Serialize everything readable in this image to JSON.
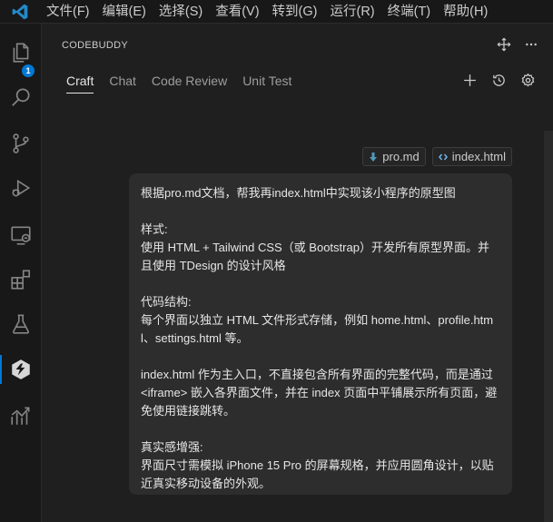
{
  "menu": [
    "文件(F)",
    "编辑(E)",
    "选择(S)",
    "查看(V)",
    "转到(G)",
    "运行(R)",
    "终端(T)",
    "帮助(H)"
  ],
  "activity": {
    "explorer_badge": "1"
  },
  "panel": {
    "title": "CODEBUDDY",
    "tabs": [
      "Craft",
      "Chat",
      "Code Review",
      "Unit Test"
    ],
    "active_tab": "Craft"
  },
  "attachments": [
    "pro.md",
    "index.html"
  ],
  "message": {
    "lines": [
      "根据pro.md文档，帮我再index.html中实现该小程序的原型图",
      "",
      "样式:",
      "使用 HTML + Tailwind CSS（或 Bootstrap）开发所有原型界面。并且使用 TDesign 的设计风格",
      "",
      "代码结构:",
      "每个界面以独立 HTML 文件形式存储，例如 home.html、profile.html、settings.html 等。",
      "",
      "index.html 作为主入口，不直接包含所有界面的完整代码，而是通过 <iframe> 嵌入各界面文件，并在 index 页面中平铺展示所有页面，避免使用链接跳转。",
      "",
      "真实感增强:",
      "界面尺寸需模拟 iPhone 15 Pro 的屏幕规格，并应用圆角设计，以贴近真实移动设备的外观。"
    ]
  },
  "colors": {
    "accent": "#0078d4",
    "background": "#1f1f1f",
    "bubble": "#2d2d2d"
  }
}
